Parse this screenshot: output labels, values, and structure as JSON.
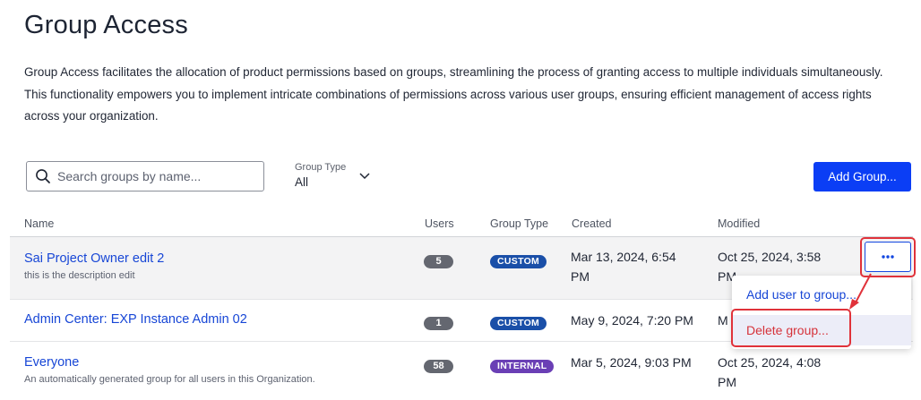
{
  "page": {
    "title": "Group Access",
    "description": "Group Access facilitates the allocation of product permissions based on groups, streamlining the process of granting access to multiple individuals simultaneously. This functionality empowers you to implement intricate combinations of permissions across various user groups, ensuring efficient management of access rights across your organization."
  },
  "toolbar": {
    "search_placeholder": "Search groups by name...",
    "filter_label": "Group Type",
    "filter_value": "All",
    "add_group_label": "Add Group..."
  },
  "table": {
    "columns": [
      "Name",
      "Users",
      "Group Type",
      "Created",
      "Modified"
    ],
    "rows": [
      {
        "name": "Sai Project Owner edit 2",
        "description": "this is the description edit",
        "users": "5",
        "type": "CUSTOM",
        "created_line1": "Mar 13, 2024, 6:54",
        "created_line2": "PM",
        "modified_line1": "Oct 25, 2024, 3:58",
        "modified_line2": "PM"
      },
      {
        "name": "Admin Center: EXP Instance Admin 02",
        "description": "",
        "users": "1",
        "type": "CUSTOM",
        "created_line1": "May 9, 2024, 7:20 PM",
        "created_line2": "",
        "modified_line1": "M",
        "modified_line2": ""
      },
      {
        "name": "Everyone",
        "description": "An automatically generated group for all users in this Organization.",
        "users": "58",
        "type": "INTERNAL",
        "created_line1": "Mar 5, 2024, 9:03 PM",
        "created_line2": "",
        "modified_line1": "Oct 25, 2024, 4:08",
        "modified_line2": "PM"
      }
    ]
  },
  "row_menu": {
    "add_user_label": "Add user to group...",
    "delete_label": "Delete group..."
  },
  "icons": {
    "search": "search-icon",
    "chevron": "chevron-down-icon",
    "more": "more-horizontal-icon"
  },
  "colors": {
    "primary": "#0b3ef5",
    "link": "#1746d6",
    "danger": "#d6323a",
    "badge_custom": "#1a4fa8",
    "badge_internal": "#6a3fb5",
    "badge_users": "#646770"
  }
}
